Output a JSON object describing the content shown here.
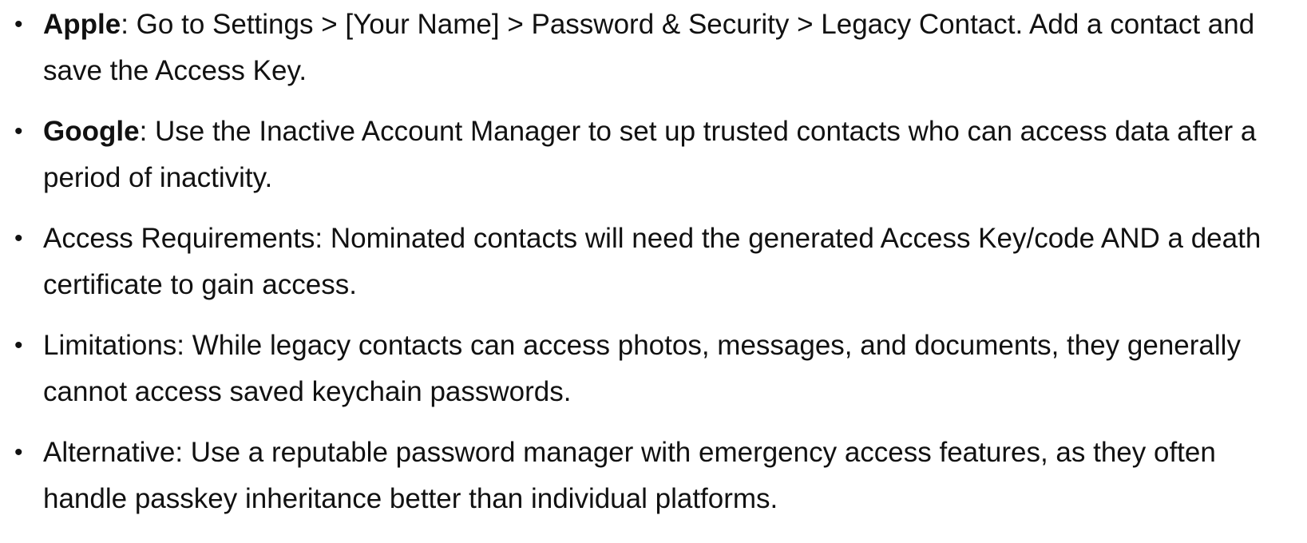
{
  "bullets": [
    {
      "term": "Apple",
      "text": ": Go to Settings > [Your Name] > Password & Security > Legacy Contact. Add a contact and save the Access Key."
    },
    {
      "term": "Google",
      "text": ": Use the Inactive Account Manager to set up trusted contacts who can access data after a period of inactivity."
    },
    {
      "term": "",
      "text": "Access Requirements: Nominated contacts will need the generated Access Key/code AND a death certificate to gain access."
    },
    {
      "term": "",
      "text": "Limitations: While legacy contacts can access photos, messages, and documents, they generally cannot access saved keychain passwords."
    },
    {
      "term": "",
      "text": "Alternative: Use a reputable password manager with emergency access features, as they often handle passkey inheritance better than individual platforms."
    }
  ],
  "bullet_glyph": "•"
}
